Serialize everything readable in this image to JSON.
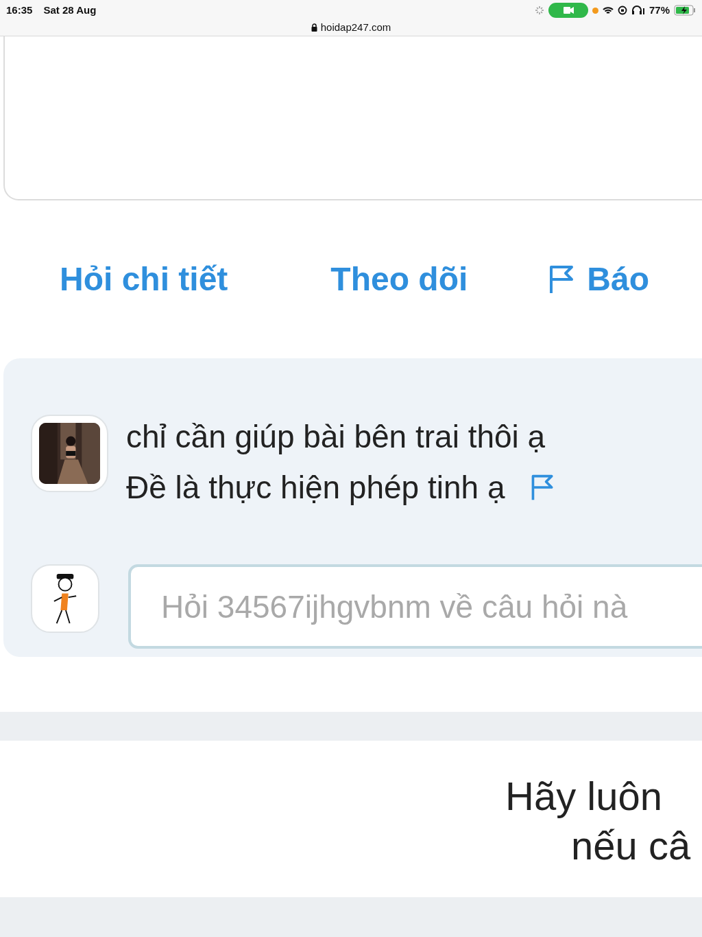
{
  "status_bar": {
    "time": "16:35",
    "date": "Sat 28 Aug",
    "battery": "77%",
    "url": "hoidap247.com"
  },
  "actions": [
    {
      "label": "Hỏi chi tiết",
      "kind": "text"
    },
    {
      "label": "Theo dõi",
      "kind": "text"
    },
    {
      "label": "Báo",
      "kind": "flag"
    }
  ],
  "comment": {
    "lines": [
      "chỉ cần giúp bài bên trai thôi ạ",
      "Đề là thực hiện phép tinh ạ"
    ],
    "reply_field": {
      "placeholder": "Hỏi 34567ijhgvbnm về câu hỏi nà"
    }
  },
  "footer": {
    "lines": [
      "Hãy luôn",
      "nếu câ"
    ]
  }
}
